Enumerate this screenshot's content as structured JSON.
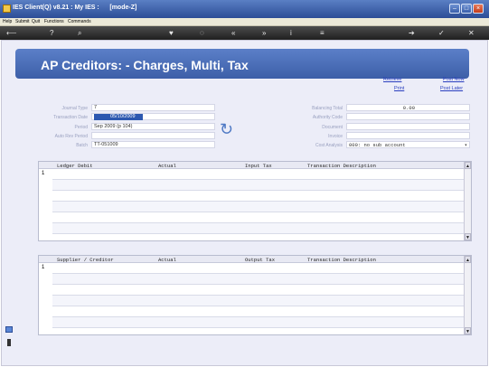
{
  "window": {
    "title": "IES Client(Q) v8.21 : My IES :      [mode-Z]",
    "minimize": "–",
    "maximize": "□",
    "close": "×"
  },
  "menu": [
    "Help",
    "Submit",
    "Quit",
    "Functions",
    "Commands"
  ],
  "toolbar": {
    "icons": [
      "back-icon",
      "help-icon",
      "search-icon",
      "favourite-icon",
      "history-icon",
      "first-icon",
      "last-icon",
      "info-icon",
      "list-icon",
      "forward-icon",
      "ok-icon",
      "cancel-icon"
    ]
  },
  "page": {
    "heading": "AP Creditors: - Charges, Multi, Tax"
  },
  "links": {
    "retrieve": "Retrieve",
    "post_now": "Post Now",
    "print": "Print",
    "post_later": "Post Later"
  },
  "form": {
    "journal_type": {
      "label": "Journal Type",
      "value": "7"
    },
    "transaction_date": {
      "label": "Transaction Date",
      "value": "05/10/2009"
    },
    "period": {
      "label": "Period",
      "value": "Sep 2009 (p 104)"
    },
    "auto_rev_period": {
      "label": "Auto Rev Period",
      "value": ""
    },
    "batch": {
      "label": "Batch",
      "value": "TT-051009"
    },
    "balancing_total": {
      "label": "Balancing Total",
      "value": "0.00"
    },
    "authority_code": {
      "label": "Authority Code",
      "value": ""
    },
    "document": {
      "label": "Document",
      "value": ""
    },
    "invoice": {
      "label": "Invoice",
      "value": ""
    },
    "cost_analysis": {
      "label": "Cost Analysis",
      "value": "000: no sub account"
    }
  },
  "grid1": {
    "columns": [
      "Ledger Debit",
      "Actual",
      "Input Tax",
      "Transaction Description"
    ],
    "row_marker": "1"
  },
  "grid2": {
    "columns": [
      "Supplier / Creditor",
      "Actual",
      "Output Tax",
      "Transaction Description"
    ],
    "row_marker": "1"
  }
}
